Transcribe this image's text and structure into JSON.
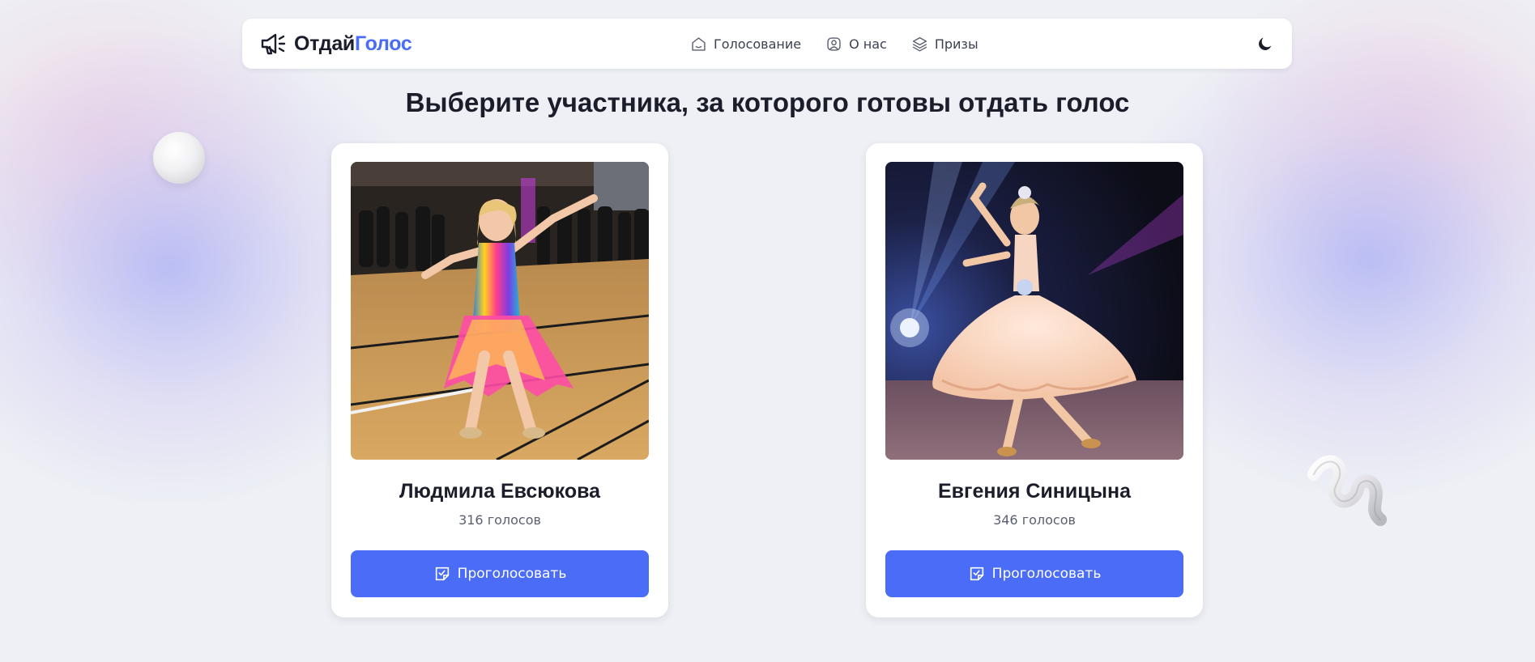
{
  "header": {
    "logo_part1": "Отдай",
    "logo_part2": "Голос",
    "nav": [
      {
        "label": "Голосование",
        "icon": "home-icon"
      },
      {
        "label": "О нас",
        "icon": "user-icon"
      },
      {
        "label": "Призы",
        "icon": "layers-icon"
      }
    ],
    "theme_icon": "moon-icon"
  },
  "page_title": "Выберите участника, за которого готовы отдать голос",
  "participants": [
    {
      "name": "Людмила Евсюкова",
      "votes": "316 голосов",
      "button": "Проголосовать",
      "photo": "Girl in a rainbow sequin dance dress on a wooden gym floor"
    },
    {
      "name": "Евгения Синицына",
      "votes": "346 голосов",
      "button": "Проголосовать",
      "photo": "Girl in a peach ballroom gown under a stage spotlight"
    }
  ],
  "colors": {
    "accent": "#4a6cf7",
    "text": "#1b1d2a",
    "background": "#eef0f5"
  }
}
